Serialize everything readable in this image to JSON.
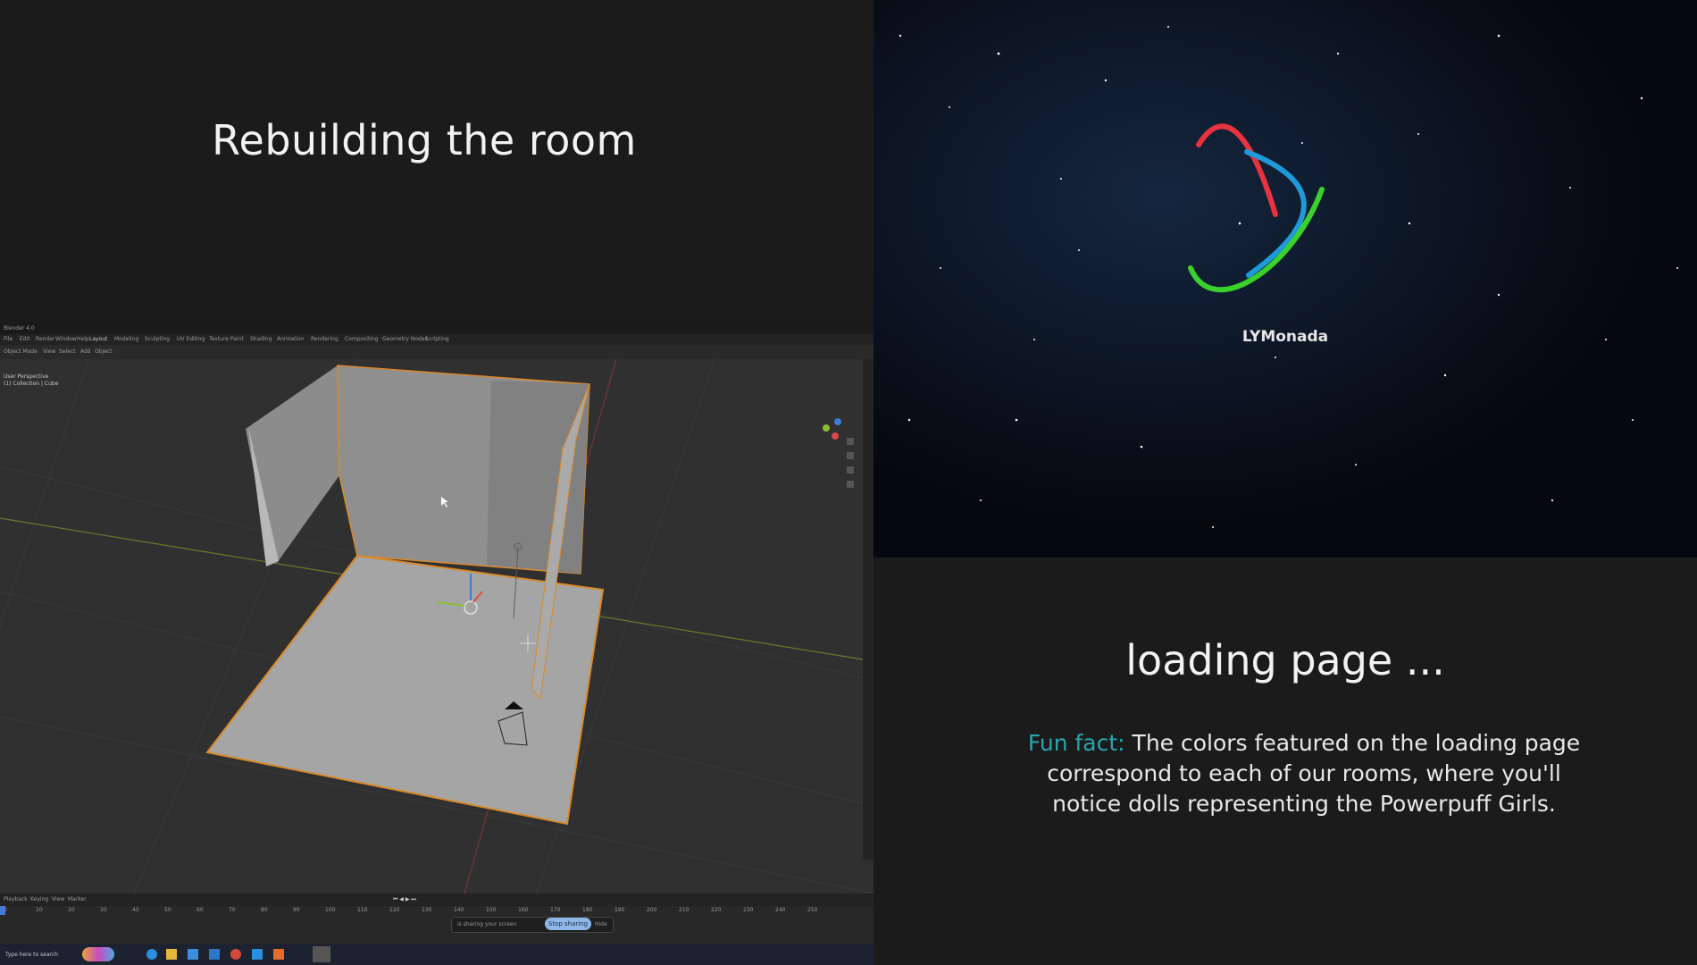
{
  "left": {
    "title": "Rebuilding the room"
  },
  "blender": {
    "window_title": "Blender 4.0",
    "menus": [
      "File",
      "Edit",
      "Render",
      "Window",
      "Help"
    ],
    "workspace_tabs": [
      "Layout",
      "Modeling",
      "Sculpting",
      "UV Editing",
      "Texture Paint",
      "Shading",
      "Animation",
      "Rendering",
      "Compositing",
      "Geometry Nodes",
      "Scripting"
    ],
    "header_left": [
      "Object Mode",
      "View",
      "Select",
      "Add",
      "Object"
    ],
    "viewport_info": [
      "User Perspective",
      "(1) Collection | Cube"
    ],
    "timeline_controls": [
      "Playback",
      "Keying",
      "View",
      "Marker"
    ],
    "timeline_numbers": [
      "0",
      "10",
      "20",
      "30",
      "40",
      "50",
      "60",
      "70",
      "80",
      "90",
      "100",
      "110",
      "120",
      "130",
      "140",
      "150",
      "160",
      "170",
      "180",
      "190",
      "200",
      "210",
      "220",
      "230",
      "240",
      "250"
    ],
    "share_notice": "is sharing your screen",
    "stop_sharing": "Stop sharing",
    "hide": "Hide",
    "taskbar_search": "Type here to search"
  },
  "right": {
    "logo_text": "LYMonada",
    "loading_title": "loading page ...",
    "fun_fact_label": "Fun fact:",
    "fun_fact_text": "The colors featured on the loading page correspond to each of our rooms, where you'll notice dolls representing the Powerpuff Girls."
  },
  "colors": {
    "red": "#e8323f",
    "blue": "#1f9ad8",
    "green": "#3bd12c",
    "accent": "#28a6ad"
  }
}
